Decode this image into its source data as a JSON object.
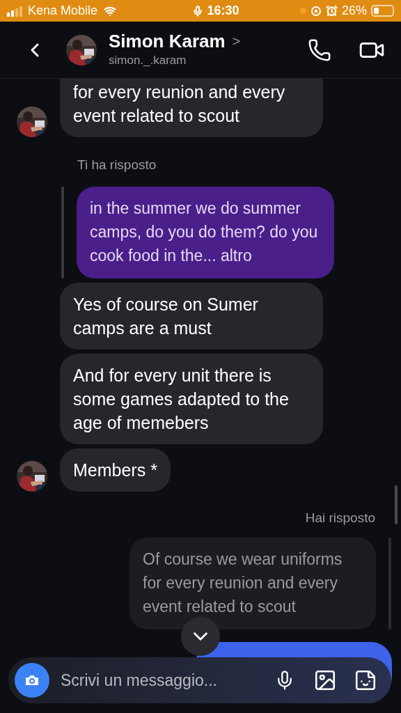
{
  "status_bar": {
    "carrier": "Kena Mobile",
    "time": "16:30",
    "battery": "26%"
  },
  "header": {
    "name": "Simon Karam",
    "chevron": ">",
    "username": "simon._.karam"
  },
  "messages": [
    {
      "kind": "incoming",
      "avatar": true,
      "cut_top": true,
      "text": "for every reunion and every event related to scout"
    },
    {
      "kind": "label_in",
      "text": "Ti ha risposto"
    },
    {
      "kind": "quote_in",
      "text": "in the summer we do summer camps, do you do them? do you cook food in the... altro"
    },
    {
      "kind": "incoming",
      "avatar": false,
      "cut_top": false,
      "text": "Yes of course on Sumer camps are a must"
    },
    {
      "kind": "incoming",
      "avatar": false,
      "cut_top": false,
      "text": "And for every unit there is some games adapted to the age of memebers"
    },
    {
      "kind": "incoming",
      "avatar": true,
      "cut_top": false,
      "text": "Members *"
    },
    {
      "kind": "label_out",
      "text": "Hai risposto"
    },
    {
      "kind": "quote_out",
      "text": "Of course we wear uniforms for every reunion and every event related to scout"
    },
    {
      "kind": "outgoing"
    }
  ],
  "composer": {
    "placeholder": "Scrivi un messaggio..."
  }
}
